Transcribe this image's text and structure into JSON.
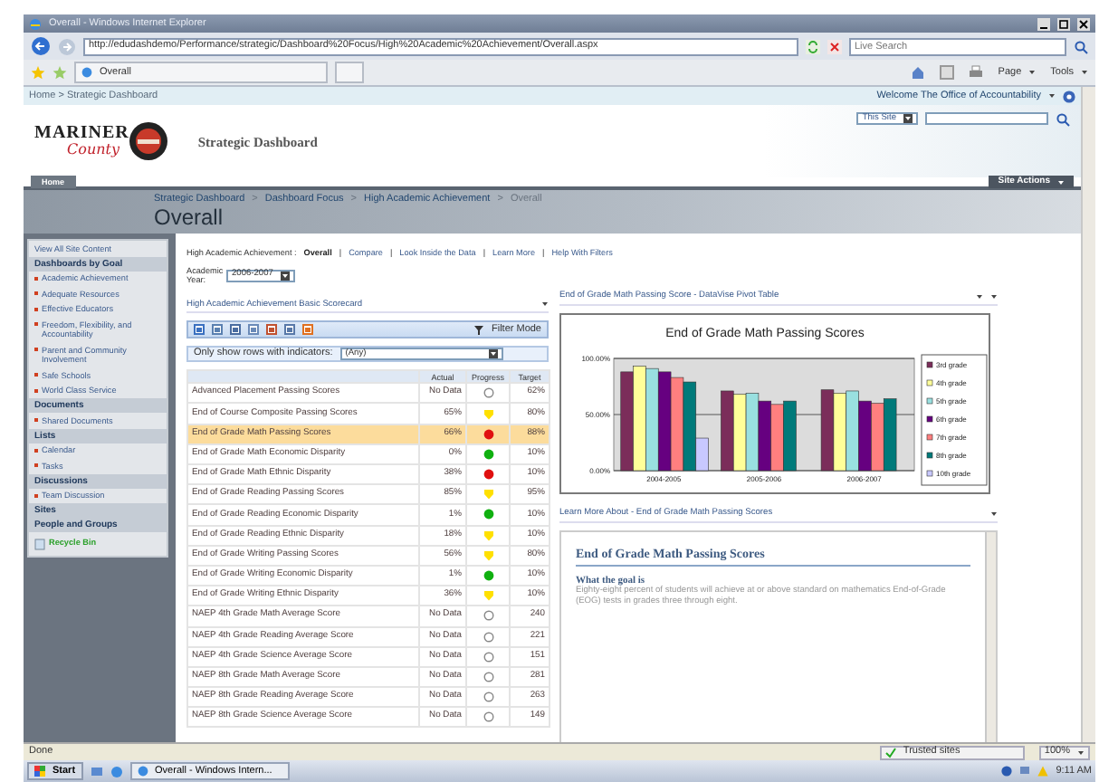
{
  "browser": {
    "title": "Overall - Windows Internet Explorer",
    "address": "http://edudashdemo/Performance/strategic/Dashboard%20Focus/High%20Academic%20Achievement/Overall.aspx",
    "search": {
      "placeholder": "Live Search"
    },
    "tab": "Overall",
    "toolbar": [
      "Page",
      "Tools"
    ]
  },
  "site": {
    "breadcrumb": "Home > Strategic Dashboard",
    "welcome": "Welcome The Office of Accountability",
    "logo": {
      "line1": "MARINER",
      "line2": "County"
    },
    "title": "Strategic Dashboard",
    "scope": "This Site",
    "nav_tabs": [
      {
        "label": "Home",
        "selected": true
      }
    ],
    "site_actions": "Site Actions"
  },
  "page": {
    "breadcrumb": [
      "Strategic Dashboard",
      "Dashboard Focus",
      "High Academic Achievement",
      "Overall"
    ],
    "separator": ">",
    "title": "Overall"
  },
  "sidebar": {
    "view_all": "View All Site Content",
    "sections": [
      {
        "heading": "Dashboards by Goal",
        "items": [
          "Academic Achievement",
          "Adequate Resources",
          "Effective Educators",
          "Freedom, Flexibility, and Accountability",
          "Parent and Community Involvement",
          "Safe Schools",
          "World Class Service"
        ]
      },
      {
        "heading": "Documents",
        "items": [
          "Shared Documents"
        ]
      },
      {
        "heading": "Lists",
        "items": [
          "Calendar",
          "Tasks"
        ]
      },
      {
        "heading": "Discussions",
        "items": [
          "Team Discussion"
        ]
      },
      {
        "heading": "Sites"
      },
      {
        "heading": "People and Groups"
      }
    ],
    "recycle_bin": "Recycle Bin"
  },
  "scorecard": {
    "filter_label": "High Academic Achievement :",
    "separator": "|",
    "links": [
      {
        "label": "Overall",
        "selected": true
      },
      {
        "label": "Compare",
        "selected": false
      },
      {
        "label": "Look Inside the Data",
        "selected": false
      },
      {
        "label": "Learn More",
        "selected": false
      },
      {
        "label": "Help With Filters",
        "selected": false
      }
    ],
    "year_label": "Academic Year:",
    "year": "2006-2007",
    "title": "High Academic Achievement Basic Scorecard",
    "filter_mode": "Filter Mode",
    "indicator_label": "Only show rows with indicators:",
    "indicator_value": "(Any)",
    "columns": [
      "Actual",
      "Progress",
      "Target"
    ],
    "rows": [
      {
        "name": "Advanced Placement Passing Scores",
        "actual": "No Data",
        "indicator": {
          "kind": "empty"
        },
        "target": "62%",
        "selected": false
      },
      {
        "name": "End of Course Composite Passing Scores",
        "actual": "65%",
        "indicator": {
          "kind": "shield",
          "color": "#ffe000"
        },
        "target": "80%",
        "selected": false
      },
      {
        "name": "End of Grade Math Passing Scores",
        "actual": "66%",
        "indicator": {
          "kind": "dot",
          "color": "#e01010"
        },
        "target": "88%",
        "selected": true
      },
      {
        "name": "End of Grade Math Economic Disparity",
        "actual": "0%",
        "indicator": {
          "kind": "dot",
          "color": "#10b010"
        },
        "target": "10%",
        "selected": false
      },
      {
        "name": "End of Grade Math Ethnic Disparity",
        "actual": "38%",
        "indicator": {
          "kind": "dot",
          "color": "#e01010"
        },
        "target": "10%",
        "selected": false
      },
      {
        "name": "End of Grade Reading Passing Scores",
        "actual": "85%",
        "indicator": {
          "kind": "shield",
          "color": "#ffe000"
        },
        "target": "95%",
        "selected": false
      },
      {
        "name": "End of Grade Reading Economic Disparity",
        "actual": "1%",
        "indicator": {
          "kind": "dot",
          "color": "#10b010"
        },
        "target": "10%",
        "selected": false
      },
      {
        "name": "End of Grade Reading Ethnic Disparity",
        "actual": "18%",
        "indicator": {
          "kind": "shield",
          "color": "#ffe000"
        },
        "target": "10%",
        "selected": false
      },
      {
        "name": "End of Grade Writing Passing Scores",
        "actual": "56%",
        "indicator": {
          "kind": "shield",
          "color": "#ffe000"
        },
        "target": "80%",
        "selected": false
      },
      {
        "name": "End of Grade Writing Economic Disparity",
        "actual": "1%",
        "indicator": {
          "kind": "dot",
          "color": "#10b010"
        },
        "target": "10%",
        "selected": false
      },
      {
        "name": "End of Grade Writing Ethnic Disparity",
        "actual": "36%",
        "indicator": {
          "kind": "shield",
          "color": "#ffe000"
        },
        "target": "10%",
        "selected": false
      },
      {
        "name": "NAEP 4th Grade Math Average Score",
        "actual": "No Data",
        "indicator": {
          "kind": "empty"
        },
        "target": "240",
        "selected": false
      },
      {
        "name": "NAEP 4th Grade Reading Average Score",
        "actual": "No Data",
        "indicator": {
          "kind": "empty"
        },
        "target": "221",
        "selected": false
      },
      {
        "name": "NAEP 4th Grade Science Average Score",
        "actual": "No Data",
        "indicator": {
          "kind": "empty"
        },
        "target": "151",
        "selected": false
      },
      {
        "name": "NAEP 8th Grade Math Average Score",
        "actual": "No Data",
        "indicator": {
          "kind": "empty"
        },
        "target": "281",
        "selected": false
      },
      {
        "name": "NAEP 8th Grade Reading Average Score",
        "actual": "No Data",
        "indicator": {
          "kind": "empty"
        },
        "target": "263",
        "selected": false
      },
      {
        "name": "NAEP 8th Grade Science Average Score",
        "actual": "No Data",
        "indicator": {
          "kind": "empty"
        },
        "target": "149",
        "selected": false
      }
    ]
  },
  "chart_panel": {
    "title": "End of Grade Math Passing Score - DataVise Pivot Table",
    "chart_data": {
      "type": "bar",
      "title": "End of Grade Math Passing Scores",
      "categories": [
        "2004-2005",
        "2005-2006",
        "2006-2007"
      ],
      "series": [
        {
          "name": "3rd grade",
          "color": "#7b2d5a",
          "values": [
            88,
            71,
            72
          ]
        },
        {
          "name": "4th grade",
          "color": "#ffff99",
          "values": [
            93,
            68,
            69
          ]
        },
        {
          "name": "5th grade",
          "color": "#99e0e0",
          "values": [
            91,
            69,
            71
          ]
        },
        {
          "name": "6th grade",
          "color": "#660080",
          "values": [
            88,
            62,
            62
          ]
        },
        {
          "name": "7th grade",
          "color": "#ff7f7f",
          "values": [
            83,
            59,
            60
          ]
        },
        {
          "name": "8th grade",
          "color": "#007a7a",
          "values": [
            79,
            62,
            64
          ]
        },
        {
          "name": "10th grade",
          "color": "#c8c8ff",
          "values": [
            29,
            null,
            null
          ]
        }
      ],
      "legend": "right",
      "ylim": [
        0,
        100
      ],
      "yticks": [
        {
          "value": 0,
          "label": "0.00%"
        },
        {
          "value": 50,
          "label": "50.00%"
        },
        {
          "value": 100,
          "label": "100.00%"
        }
      ]
    }
  },
  "learn_more": {
    "title": "Learn More About - End of Grade Math Passing Scores",
    "heading": "End of Grade Math Passing Scores",
    "subheading": "What the goal is",
    "text": "Eighty-eight percent of students will achieve at or above standard on mathematics End-of-Grade (EOG) tests in grades three through eight."
  },
  "status_bar": {
    "text": "Done",
    "zone": "Trusted sites",
    "zoom": "100%"
  },
  "taskbar": {
    "start": "Start",
    "window": "Overall - Windows Intern...",
    "time": "9:11 AM"
  }
}
